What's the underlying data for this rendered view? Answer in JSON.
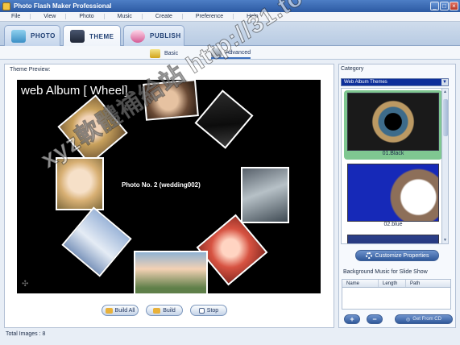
{
  "window": {
    "title": "Photo Flash Maker Professional"
  },
  "menu": [
    "File",
    "View",
    "Photo",
    "Music",
    "Create",
    "Preference",
    "Help"
  ],
  "tabs": [
    {
      "label": "PHOTO",
      "icon": "photo-tab-icon"
    },
    {
      "label": "THEME",
      "icon": "theme-tab-icon",
      "active": true
    },
    {
      "label": "PUBLISH",
      "icon": "publish-tab-icon"
    }
  ],
  "subtabs": [
    {
      "label": "Basic"
    },
    {
      "label": "Advanced",
      "active": true
    }
  ],
  "preview": {
    "label": "Theme Preview:",
    "stage_title": "web Album [ Wheel]",
    "caption": "Photo No. 2 (wedding002)"
  },
  "buttons": {
    "build_all": "Build All",
    "build": "Build",
    "stop": "Stop"
  },
  "status": {
    "total_images": "Total Images : 8"
  },
  "category": {
    "label": "Category",
    "selected": "Web Album Themes"
  },
  "themes": [
    {
      "name": "01.Black",
      "selected": true
    },
    {
      "name": "02.blue",
      "selected": false
    }
  ],
  "customize_label": "Customize Properties",
  "music": {
    "label": "Background Music for Slide Show",
    "columns": [
      "Name",
      "Length",
      "Path"
    ],
    "add": "+",
    "remove": "−",
    "cd_label": "Get From CD"
  },
  "watermark": "xyz軟體補給站 http://31.to",
  "colors": {
    "accent": "#3c6fbd",
    "selected_theme": "#7fc791",
    "stage_bg": "#000000"
  }
}
